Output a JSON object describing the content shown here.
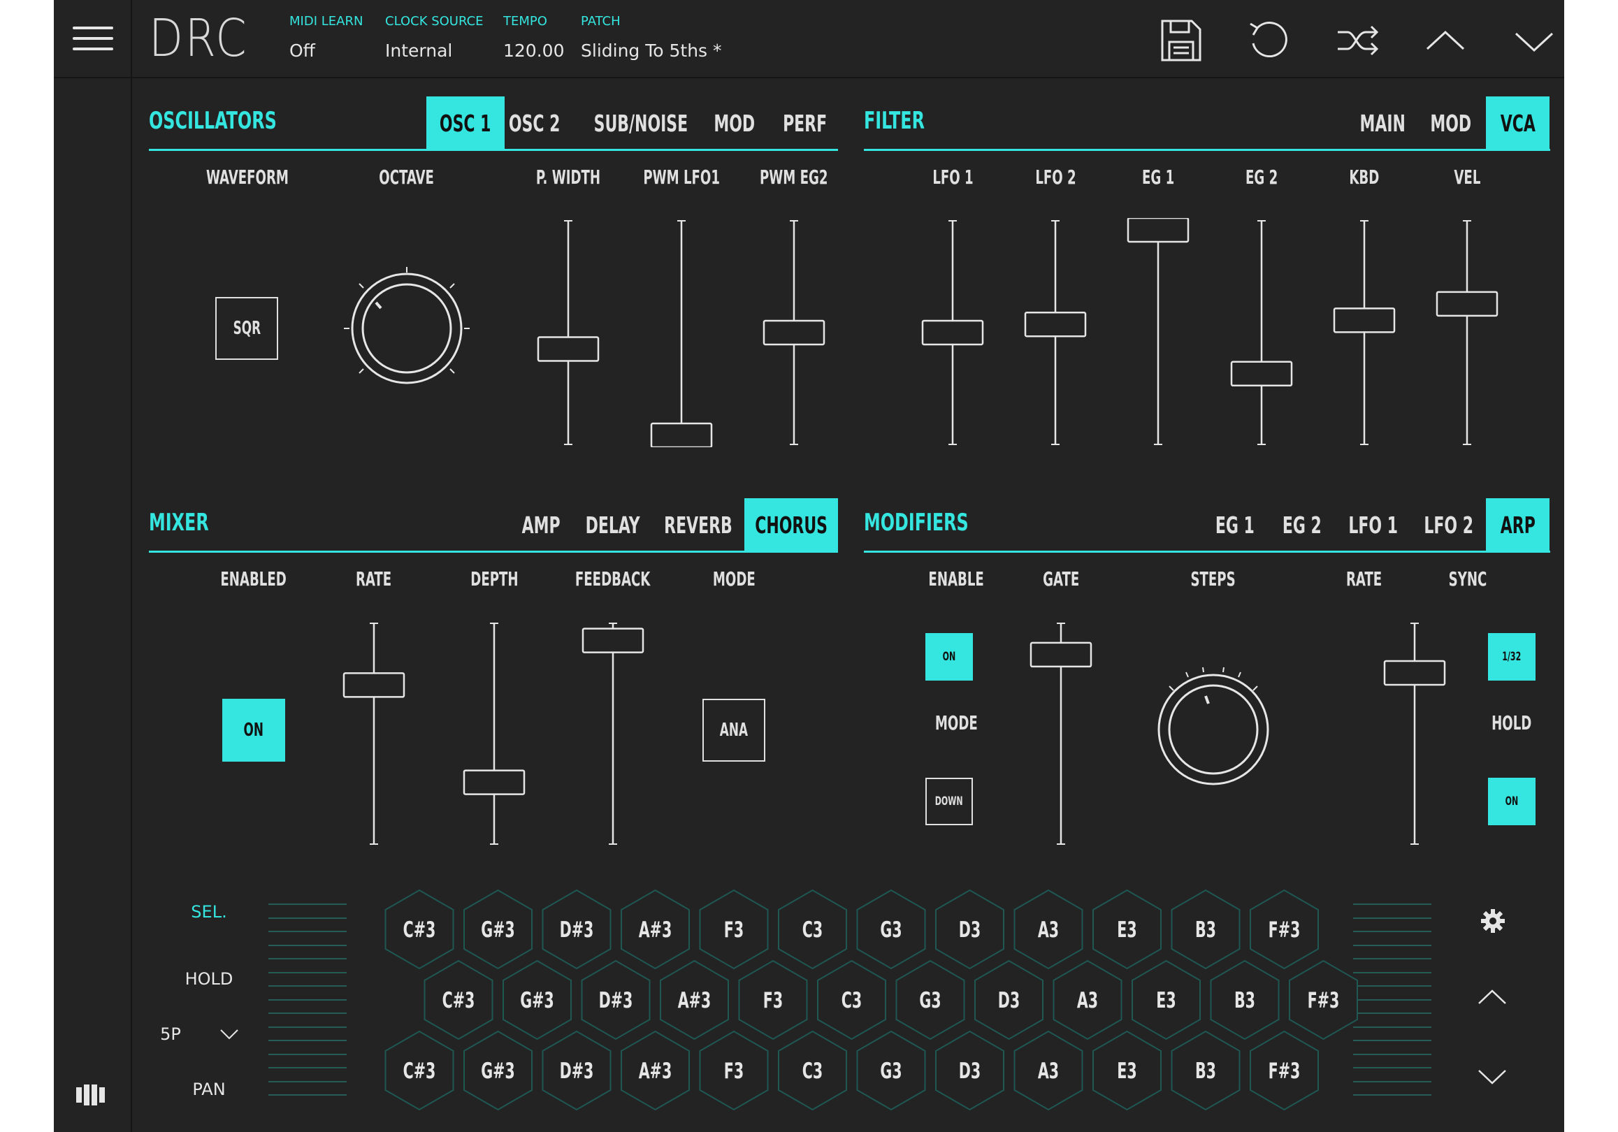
{
  "app": {
    "logo": "DRC",
    "accent": "#35e6e0",
    "bg": "#232323"
  },
  "header": {
    "fields": [
      {
        "label": "MIDI LEARN",
        "value": "Off"
      },
      {
        "label": "CLOCK SOURCE",
        "value": "Internal"
      },
      {
        "label": "TEMPO",
        "value": "120.00"
      },
      {
        "label": "PATCH",
        "value": "Sliding To 5ths *"
      }
    ],
    "icons": [
      "save-icon",
      "undo-icon",
      "shuffle-icon",
      "chevron-up-icon",
      "chevron-down-icon"
    ]
  },
  "oscillators": {
    "title": "OSCILLATORS",
    "tabs": [
      {
        "label": "OSC 1",
        "active": true
      },
      {
        "label": "OSC 2"
      },
      {
        "label": "SUB/NOISE"
      },
      {
        "label": "MOD"
      },
      {
        "label": "PERF"
      }
    ],
    "controls": [
      {
        "label": "WAVEFORM",
        "type": "button",
        "value": "SQR"
      },
      {
        "label": "OCTAVE",
        "type": "knob"
      },
      {
        "label": "P. WIDTH",
        "type": "slider",
        "level": 0.42
      },
      {
        "label": "PWM LFO1",
        "type": "slider",
        "level": 0.0
      },
      {
        "label": "PWM EG2",
        "type": "slider",
        "level": 0.5
      }
    ]
  },
  "filter": {
    "title": "FILTER",
    "tabs": [
      {
        "label": "MAIN"
      },
      {
        "label": "MOD"
      },
      {
        "label": "VCA",
        "active": true
      }
    ],
    "controls": [
      {
        "label": "LFO 1",
        "level": 0.5
      },
      {
        "label": "LFO 2",
        "level": 0.54
      },
      {
        "label": "EG 1",
        "level": 1.0
      },
      {
        "label": "EG 2",
        "level": 0.3
      },
      {
        "label": "KBD",
        "level": 0.56
      },
      {
        "label": "VEL",
        "level": 0.64
      }
    ]
  },
  "mixer": {
    "title": "MIXER",
    "tabs": [
      {
        "label": "AMP"
      },
      {
        "label": "DELAY"
      },
      {
        "label": "REVERB"
      },
      {
        "label": "CHORUS",
        "active": true
      }
    ],
    "controls": [
      {
        "label": "ENABLED",
        "type": "toggle",
        "value": "ON"
      },
      {
        "label": "RATE",
        "type": "slider",
        "level": 0.74
      },
      {
        "label": "DEPTH",
        "type": "slider",
        "level": 0.26
      },
      {
        "label": "FEEDBACK",
        "type": "slider",
        "level": 0.96
      },
      {
        "label": "MODE",
        "type": "button",
        "value": "ANA"
      }
    ]
  },
  "modifiers": {
    "title": "MODIFIERS",
    "tabs": [
      {
        "label": "EG 1"
      },
      {
        "label": "EG 2"
      },
      {
        "label": "LFO 1"
      },
      {
        "label": "LFO 2"
      },
      {
        "label": "ARP",
        "active": true
      }
    ],
    "enable_label": "ENABLE",
    "enable_value": "ON",
    "mode_label": "MODE",
    "mode_value": "DOWN",
    "gate_label": "GATE",
    "gate_level": 0.89,
    "steps_label": "STEPS",
    "rate_label": "RATE",
    "rate_level": 0.8,
    "sync_label": "SYNC",
    "sync_value": "1/32",
    "hold_label": "HOLD",
    "hold_value": "ON"
  },
  "keyboard": {
    "side": {
      "sel": "SEL.",
      "hold": "HOLD",
      "preset": "5P",
      "pan": "PAN"
    },
    "rows": [
      [
        "C#3",
        "G#3",
        "D#3",
        "A#3",
        "F3",
        "C3",
        "G3",
        "D3",
        "A3",
        "E3",
        "B3",
        "F#3"
      ],
      [
        "C#3",
        "G#3",
        "D#3",
        "A#3",
        "F3",
        "C3",
        "G3",
        "D3",
        "A3",
        "E3",
        "B3",
        "F#3"
      ],
      [
        "C#3",
        "G#3",
        "D#3",
        "A#3",
        "F3",
        "C3",
        "G3",
        "D3",
        "A3",
        "E3",
        "B3",
        "F#3"
      ]
    ],
    "right_icons": [
      "gear-icon",
      "chevron-up-icon",
      "chevron-down-icon"
    ],
    "left_icon": "keyboard-layout-icon"
  }
}
